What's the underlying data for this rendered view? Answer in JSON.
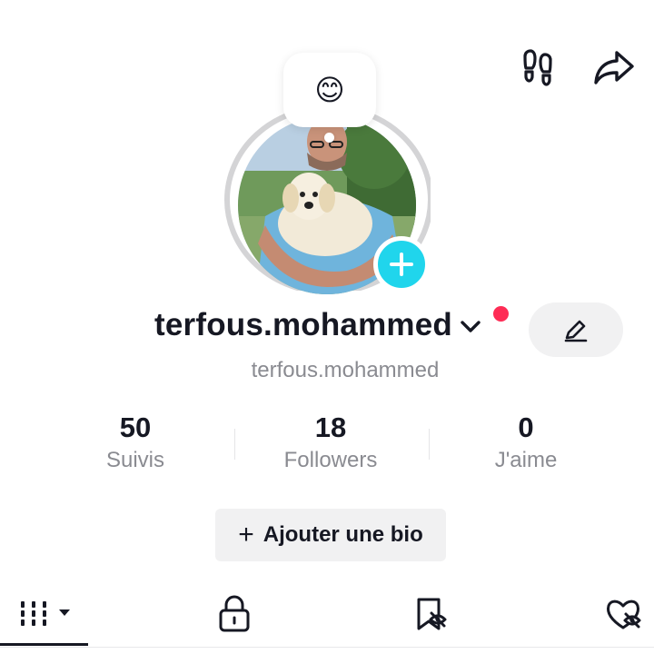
{
  "header": {
    "footprint_icon": "footprints-icon",
    "share_icon": "share-arrow-icon"
  },
  "profile": {
    "status_emoji": "😊",
    "username": "terfous.mohammed",
    "handle": "terfous.mohammed",
    "notification_color": "#fe2c55",
    "add_badge_color": "#20d5ec"
  },
  "stats": [
    {
      "value": "50",
      "label": "Suivis"
    },
    {
      "value": "18",
      "label": "Followers"
    },
    {
      "value": "0",
      "label": "J'aime"
    }
  ],
  "bio_button": {
    "plus": "+",
    "label": "Ajouter une bio"
  },
  "tabs": [
    {
      "icon": "grid-videos-icon",
      "active": true
    },
    {
      "icon": "lock-icon",
      "active": false
    },
    {
      "icon": "bookmark-icon",
      "active": false
    },
    {
      "icon": "liked-heart-icon",
      "active": false
    }
  ]
}
